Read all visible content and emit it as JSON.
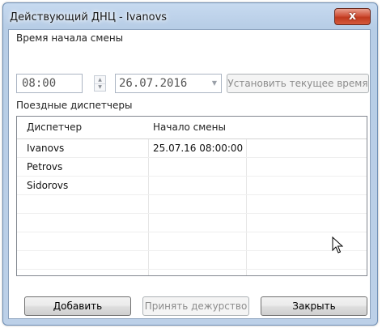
{
  "window": {
    "title": "Действующий ДНЦ - Ivanovs",
    "close_glyph": "x"
  },
  "shift": {
    "start_label": "Время начала смены",
    "time_value": "08:00",
    "date_value": "26.07.2016",
    "set_current_button": "Установить текущее время"
  },
  "dispatchers": {
    "section_label": "Поездные диспетчеры",
    "columns": [
      "Диспетчер",
      "Начало смены"
    ],
    "rows": [
      [
        "Ivanovs",
        "25.07.16 08:00:00"
      ],
      [
        "Petrovs",
        ""
      ],
      [
        "Sidorovs",
        ""
      ]
    ]
  },
  "buttons": {
    "add": "Добавить",
    "accept_duty": "Принять дежурство",
    "close": "Закрыть"
  },
  "colors": {
    "close_button": "#c03a1f",
    "title_bar": "#b7cde6"
  }
}
